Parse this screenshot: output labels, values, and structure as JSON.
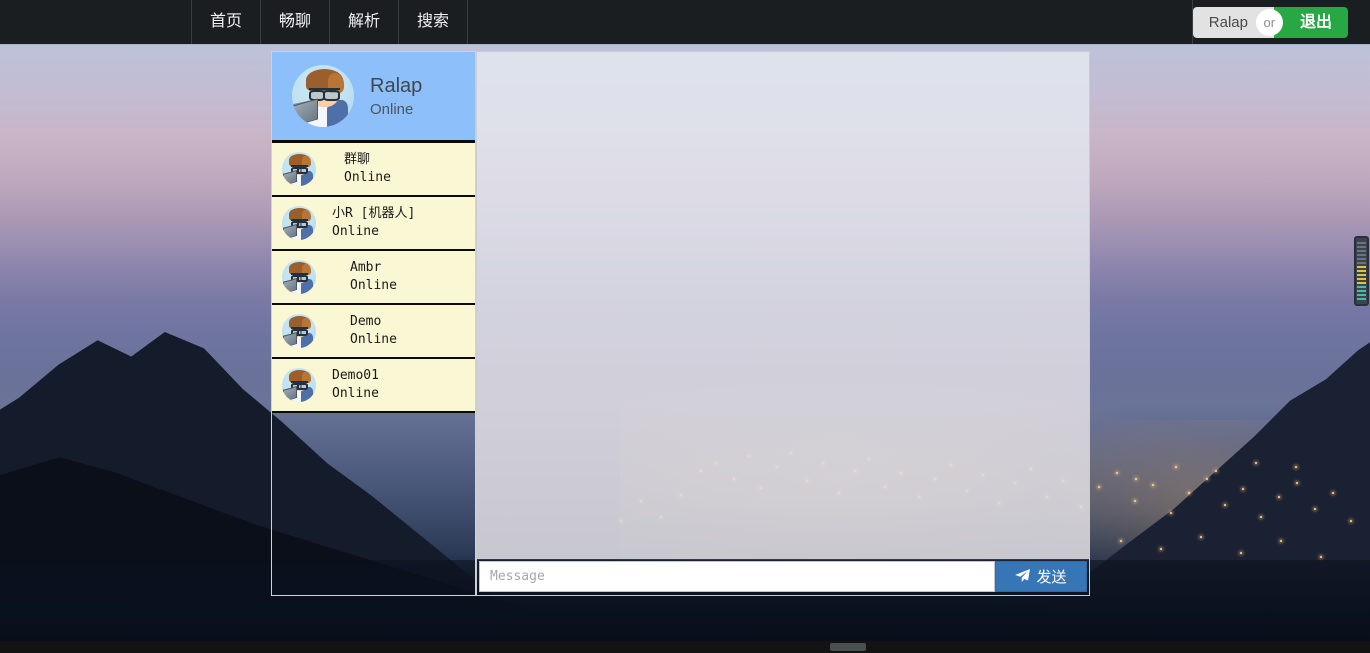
{
  "navbar": {
    "links": [
      {
        "label": "首页",
        "name": "nav-link-home"
      },
      {
        "label": "畅聊",
        "name": "nav-link-chat"
      },
      {
        "label": "解析",
        "name": "nav-link-parse"
      },
      {
        "label": "搜索",
        "name": "nav-link-search"
      }
    ],
    "user_button": "Ralap",
    "or_badge": "or",
    "logout_button": "退出",
    "background_color": "#1b1e21",
    "logout_color": "#28a745"
  },
  "userlist": {
    "selected": {
      "name": "Ralap",
      "status": "Online"
    },
    "items": [
      {
        "name": "群聊",
        "status": "Online",
        "indent": "indent-3"
      },
      {
        "name": "小R [机器人]",
        "status": "Online",
        "indent": "indent-1"
      },
      {
        "name": "Ambr",
        "status": "Online",
        "indent": "indent-2"
      },
      {
        "name": "Demo",
        "status": "Online",
        "indent": "indent-2"
      },
      {
        "name": "Demo01",
        "status": "Online",
        "indent": "indent-1"
      }
    ],
    "selected_color": "#8dc0fb",
    "item_color": "#faf7d4"
  },
  "chat": {
    "messages": [],
    "input_placeholder": "Message",
    "input_value": "",
    "send_label": "发送",
    "send_icon": "paper-plane-icon",
    "send_color": "#3776b6"
  }
}
